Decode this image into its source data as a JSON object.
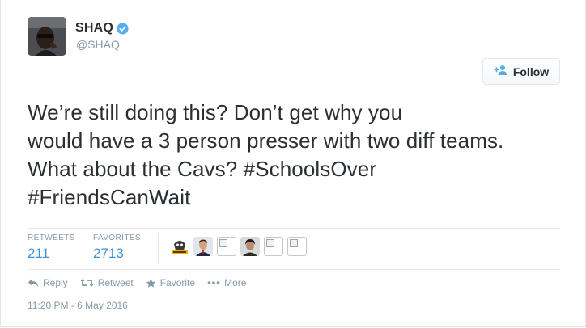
{
  "user": {
    "display_name": "SHAQ",
    "handle": "@SHAQ",
    "verified": true
  },
  "follow_button": {
    "label": "Follow"
  },
  "tweet": {
    "lines": [
      "We’re still doing this? Don’t get why you",
      "would have a 3 person presser with two diff teams.",
      "What about the Cavs? #SchoolsOver",
      "#FriendsCanWait"
    ],
    "hashtags": [
      "#SchoolsOver",
      "#FriendsCanWait"
    ]
  },
  "stats": {
    "retweets_label": "RETWEETS",
    "retweets_count": "211",
    "favorites_label": "FAVORITES",
    "favorites_count": "2713"
  },
  "actions": {
    "reply": "Reply",
    "retweet": "Retweet",
    "favorite": "Favorite",
    "more": "More"
  },
  "timestamp": "11:20 PM - 6 May 2016",
  "colors": {
    "accent": "#3b94d9",
    "muted": "#8899a6",
    "text": "#292f33",
    "border": "#e1e8ed",
    "verified": "#55acee"
  }
}
